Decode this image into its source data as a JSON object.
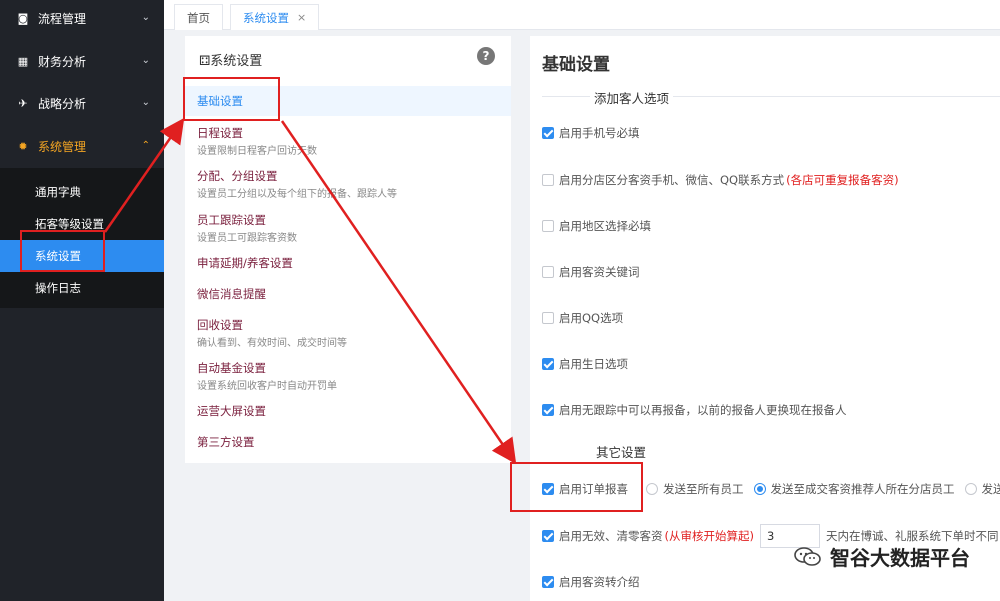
{
  "sidebar": {
    "items": [
      {
        "label": "流程管理",
        "icon": "camera-icon",
        "glyph": "◙"
      },
      {
        "label": "财务分析",
        "icon": "chart-icon",
        "glyph": "▦"
      },
      {
        "label": "战略分析",
        "icon": "plane-icon",
        "glyph": "✈"
      },
      {
        "label": "系统管理",
        "icon": "gear-icon",
        "glyph": "✹"
      }
    ],
    "submenu": [
      "通用字典",
      "拓客等级设置",
      "系统设置",
      "操作日志"
    ]
  },
  "tabs": [
    {
      "label": "首页"
    },
    {
      "label": "系统设置",
      "close": "×"
    }
  ],
  "middle": {
    "title": "⚃系统设置",
    "help": "?",
    "items": [
      {
        "label": "基础设置",
        "desc": ""
      },
      {
        "label": "日程设置",
        "desc": "设置限制日程客户回访天数"
      },
      {
        "label": "分配、分组设置",
        "desc": "设置员工分组以及每个组下的报备、跟踪人等"
      },
      {
        "label": "员工跟踪设置",
        "desc": "设置员工可跟踪客资数"
      },
      {
        "label": "申请延期/养客设置",
        "desc": ""
      },
      {
        "label": "微信消息提醒",
        "desc": ""
      },
      {
        "label": "回收设置",
        "desc": "确认看到、有效时间、成交时间等"
      },
      {
        "label": "自动基金设置",
        "desc": "设置系统回收客户时自动开罚单"
      },
      {
        "label": "运营大屏设置",
        "desc": ""
      },
      {
        "label": "第三方设置",
        "desc": ""
      }
    ]
  },
  "right": {
    "title": "基础设置",
    "section1": "添加客人选项",
    "options": [
      {
        "label": "启用手机号必填",
        "checked": true,
        "note": ""
      },
      {
        "label": "启用分店区分客资手机、微信、QQ联系方式",
        "checked": false,
        "note": "(各店可重复报备客资)"
      },
      {
        "label": "启用地区选择必填",
        "checked": false,
        "note": ""
      },
      {
        "label": "启用客资关键词",
        "checked": false,
        "note": ""
      },
      {
        "label": "启用QQ选项",
        "checked": false,
        "note": ""
      },
      {
        "label": "启用生日选项",
        "checked": true,
        "note": ""
      },
      {
        "label": "启用无跟踪中可以再报备，以前的报备人更换现在报备人",
        "checked": true,
        "note": ""
      }
    ],
    "section2": "其它设置",
    "order_report": {
      "label": "启用订单报喜",
      "checked": true,
      "radios": [
        {
          "label": "发送至所有员工",
          "selected": false
        },
        {
          "label": "发送至成交客资推荐人所在分店员工",
          "selected": true
        },
        {
          "label": "发送至",
          "selected": false
        }
      ]
    },
    "invalid_clear": {
      "label": "启用无效、清零客资",
      "checked": true,
      "note": "(从审核开始算起)",
      "value": "3",
      "suffix": "天内在博诚、礼服系统下单时不同"
    },
    "transfer": {
      "label": "启用客资转介绍",
      "checked": true
    }
  },
  "watermark": {
    "text": "智谷大数据平台",
    "icon": "wechat-icon"
  }
}
